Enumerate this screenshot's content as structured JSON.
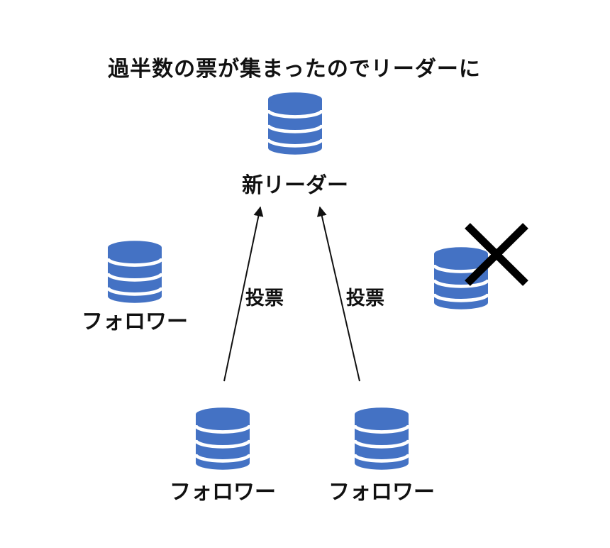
{
  "diagram": {
    "title": "過半数の票が集まったのでリーダーに",
    "nodes": {
      "leader": {
        "label": "新リーダー",
        "icon": "database-icon"
      },
      "follower_left": {
        "label": "フォロワー",
        "icon": "database-icon"
      },
      "follower_bottom_left": {
        "label": "フォロワー",
        "icon": "database-icon"
      },
      "follower_bottom_right": {
        "label": "フォロワー",
        "icon": "database-icon"
      },
      "failed_node": {
        "label": "",
        "icon": "database-icon",
        "status_icon": "cross-icon"
      }
    },
    "edges": [
      {
        "from": "follower_bottom_left",
        "to": "leader",
        "label": "投票"
      },
      {
        "from": "follower_bottom_right",
        "to": "leader",
        "label": "投票"
      }
    ]
  },
  "colors": {
    "database_fill": "#4472c4",
    "database_band": "#ffffff",
    "text": "#111111",
    "arrow": "#111111",
    "cross": "#000000"
  }
}
